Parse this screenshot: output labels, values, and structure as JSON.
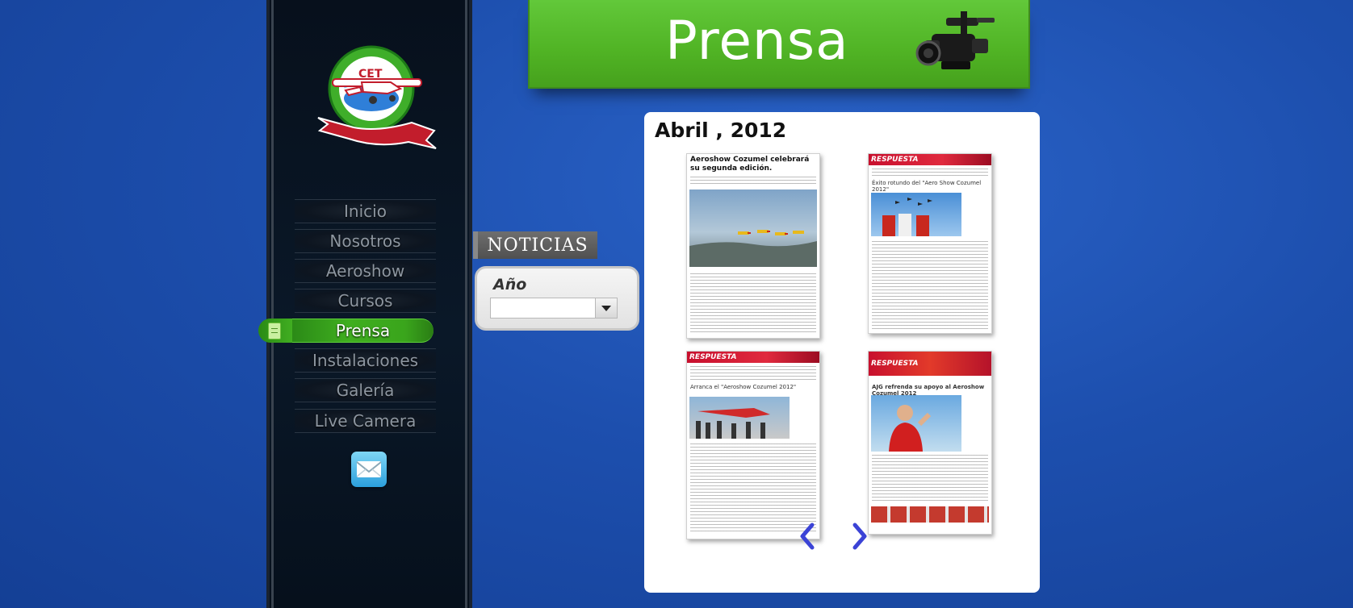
{
  "header": {
    "title": "Prensa"
  },
  "nav": {
    "items": [
      {
        "label": "Inicio"
      },
      {
        "label": "Nosotros"
      },
      {
        "label": "Aeroshow"
      },
      {
        "label": "Cursos"
      },
      {
        "label": "Prensa"
      },
      {
        "label": "Instalaciones"
      },
      {
        "label": "Galería"
      },
      {
        "label": "Live Camera"
      }
    ],
    "active": "Prensa"
  },
  "logo": {
    "alt": "Aerodromo CET Cap. Eduardo Toledo"
  },
  "noticias": {
    "label": "NOTICIAS"
  },
  "filter": {
    "year_label": "Año",
    "year_value": ""
  },
  "content": {
    "month_title": "Abril , 2012",
    "clips": [
      {
        "headline": "Aeroshow Cozumel celebrará su segunda edición."
      },
      {
        "masthead": "RESPUESTA",
        "headline": "Éxito rotundo del \"Aero Show Cozumel 2012\""
      },
      {
        "masthead": "RESPUESTA",
        "headline": "Arranca el \"Aeroshow Cozumel 2012\""
      },
      {
        "masthead": "RESPUESTA",
        "headline": "AJG refrenda su apoyo al Aeroshow Cozumel 2012"
      }
    ]
  },
  "colors": {
    "background": "#1d4fae",
    "header_green": "#52b528",
    "active_nav": "#3aa51c",
    "pager_arrow": "#3b43d6"
  },
  "icons": {
    "camera": "video-camera-icon",
    "mail": "envelope-icon",
    "prev": "chevron-left-icon",
    "next": "chevron-right-icon",
    "dropdown": "chevron-down-icon"
  }
}
